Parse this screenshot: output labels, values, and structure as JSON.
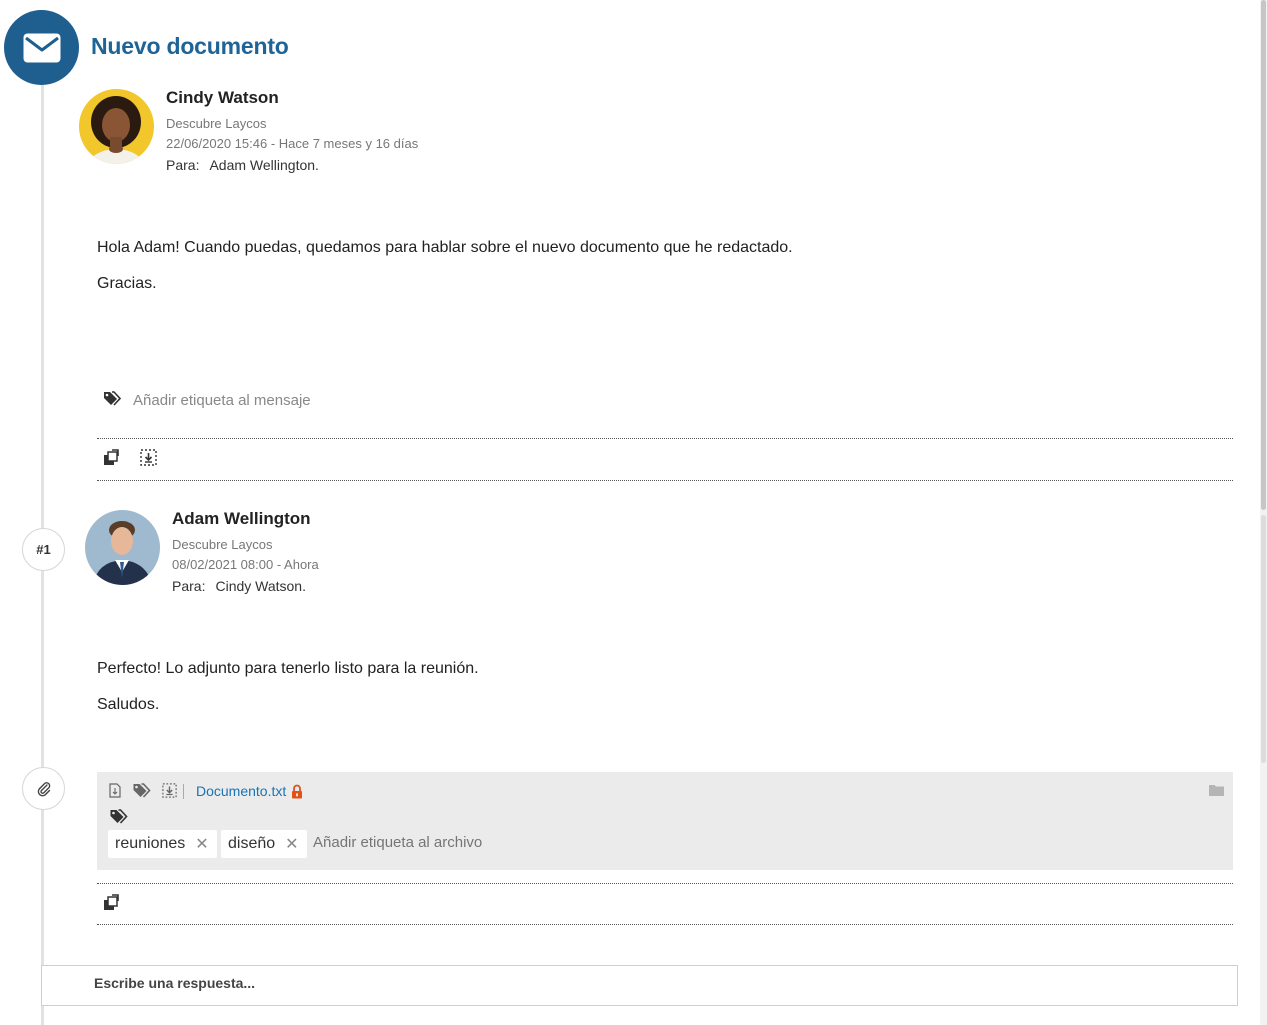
{
  "page": {
    "title": "Nuevo documento"
  },
  "messages": [
    {
      "sender": "Cindy Watson",
      "workspace": "Descubre Laycos",
      "datetime": "22/06/2020 15:46 - Hace 7 meses y 16 días",
      "to_label": "Para:",
      "to": "Adam Wellington.",
      "body": [
        "Hola Adam! Cuando puedas, quedamos para hablar sobre el nuevo documento que he redactado.",
        "Gracias."
      ],
      "tag_placeholder": "Añadir etiqueta al mensaje"
    },
    {
      "index": "#1",
      "sender": "Adam Wellington",
      "workspace": "Descubre Laycos",
      "datetime": "08/02/2021 08:00 - Ahora",
      "to_label": "Para:",
      "to": "Cindy Watson.",
      "body": [
        "Perfecto! Lo adjunto para tenerlo listo para la reunión.",
        "Saludos."
      ]
    }
  ],
  "attachment": {
    "file_name": "Documento.txt",
    "tags": [
      "reuniones",
      "diseño"
    ],
    "remove_symbol": "✕",
    "tag_placeholder": "Añadir etiqueta al archivo"
  },
  "reply": {
    "placeholder": "Escribe una respuesta..."
  },
  "colors": {
    "brand": "#1f5f8f",
    "title": "#1f6497",
    "link": "#1a73b4",
    "lock": "#e0521a",
    "avatar_bg_cindy": "#f2c72c",
    "avatar_bg_adam": "#9fb9cf"
  },
  "icons": {
    "header": "envelope-icon",
    "tag": "tags-icon",
    "forward": "forward-copy-icon",
    "download": "download-icon",
    "attachment": "paperclip-icon",
    "lock": "lock-icon",
    "folder": "folder-icon"
  }
}
